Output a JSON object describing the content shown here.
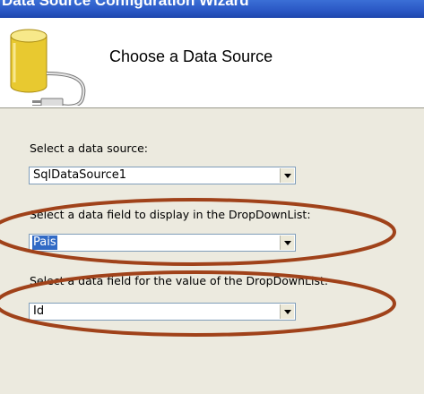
{
  "window": {
    "title": "Data Source Configuration Wizard"
  },
  "header": {
    "title": "Choose a Data Source"
  },
  "fields": {
    "datasource": {
      "label": "Select a data source:",
      "value": "SqlDataSource1"
    },
    "display_field": {
      "label": "Select a data field to display in the DropDownList:",
      "value": "Pais"
    },
    "value_field": {
      "label": "Select a data field for the value of the DropDownList:",
      "value": "Id"
    }
  },
  "colors": {
    "annotation": "#a0421a",
    "titlebar": "#2a57c4",
    "selection": "#316ac5"
  },
  "icons": {
    "header": "database-icon",
    "dropdown": "chevron-down-icon"
  }
}
